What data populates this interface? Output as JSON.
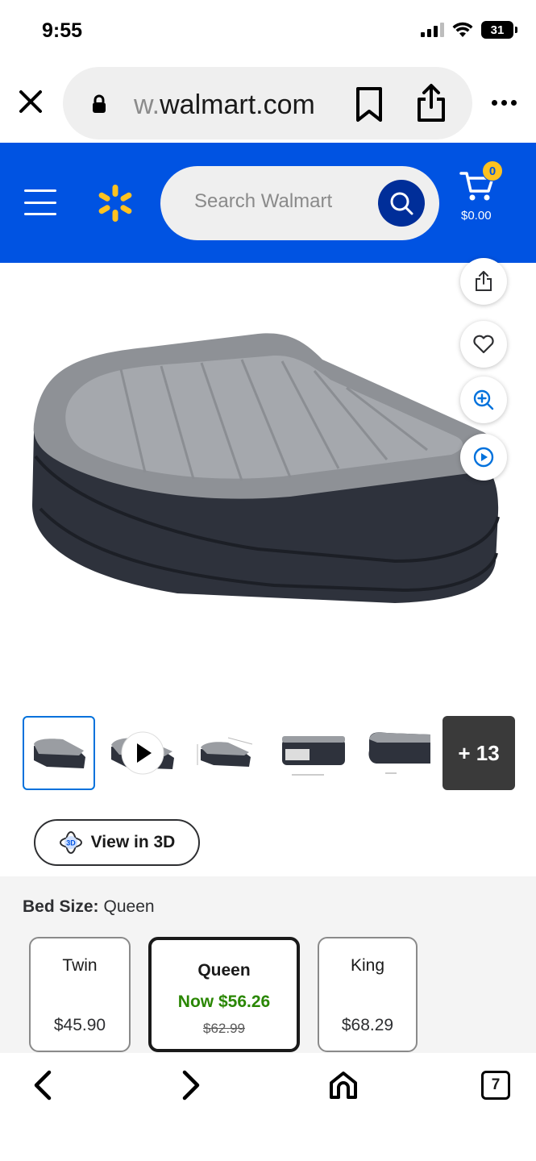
{
  "status_bar": {
    "time": "9:55",
    "battery": "31"
  },
  "browser": {
    "url_prefix": "w.",
    "url_domain": "walmart.com"
  },
  "header": {
    "search_placeholder": "Search Walmart",
    "cart_count": "0",
    "cart_total": "$0.00",
    "brand_color": "#0053e2",
    "accent_color": "#ffc220"
  },
  "gallery": {
    "more_label": "+ 13",
    "view_3d_label": "View in 3D",
    "view_3d_badge": "3D"
  },
  "variant": {
    "label": "Bed Size:",
    "selected": "Queen",
    "options": [
      {
        "name": "Twin",
        "price": "$45.90"
      },
      {
        "name": "Queen",
        "now_price": "Now $56.26",
        "was_price": "$62.99"
      },
      {
        "name": "King",
        "price": "$68.29"
      }
    ],
    "sale_color": "#2a8703"
  },
  "toolbar": {
    "tab_count": "7"
  },
  "icons": [
    "close-icon",
    "lock-icon",
    "bookmark-icon",
    "share-icon",
    "more-icon",
    "menu-icon",
    "spark-logo-icon",
    "search-icon",
    "cart-icon",
    "share-product-icon",
    "heart-icon",
    "zoom-icon",
    "play-icon",
    "back-icon",
    "forward-icon",
    "home-icon",
    "tabs-icon"
  ]
}
